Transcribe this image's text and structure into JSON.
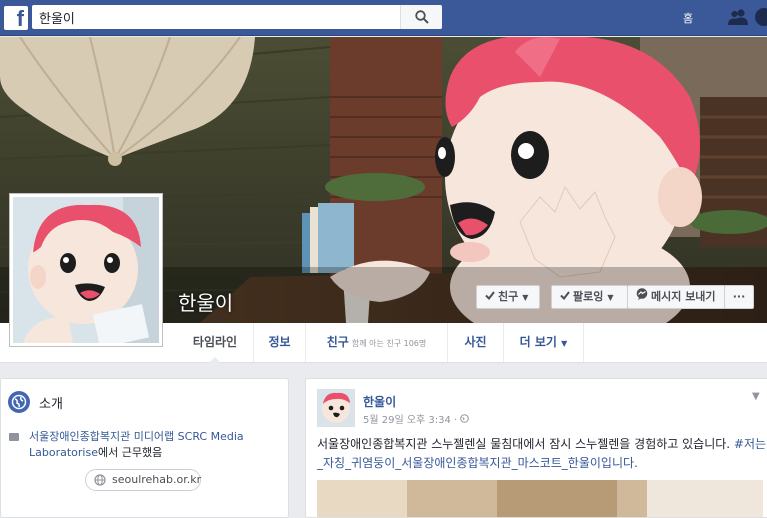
{
  "topbar": {
    "logo": "f",
    "search_value": "한울이",
    "home_label": "홈",
    "brand_color": "#3b5998"
  },
  "profile": {
    "name": "한울이"
  },
  "cover_actions": {
    "friend_label": "친구",
    "following_label": "팔로잉",
    "message_label": "메시지 보내기",
    "more_label": "···"
  },
  "tabs": {
    "timeline": "타임라인",
    "about": "정보",
    "friends": "친구",
    "friends_sub": "함께 아는 친구 106명",
    "photos": "사진",
    "more": "더 보기"
  },
  "intro": {
    "title": "소개",
    "work_link": "서울장애인종합복지관 미디어랩 SCRC Media Laboratorise",
    "work_suffix": "에서 근무했음",
    "website": "seoulrehab.or.kr"
  },
  "post": {
    "author": "한울이",
    "meta": "5월 29일 오후 3:34 · ",
    "text": "서울장애인종합복지관 스누젤렌실 물침대에서 잠시 스누젤렌을 경험하고 있습니다. ",
    "tags": "#저는_자칭_귀염둥이_서울장애인종합복지관_마스코트_한울이입니다."
  },
  "colors": {
    "link": "#365899",
    "mascot_hair": "#e9506c",
    "mascot_face": "#f7e6dc",
    "page_bg": "#e9ebee"
  },
  "icons": [
    "facebook-logo",
    "search-icon",
    "friends-icon",
    "quick-help-icon",
    "check-icon",
    "message-icon",
    "globe-icon",
    "briefcase-icon",
    "public-icon",
    "chevron-down-icon"
  ]
}
